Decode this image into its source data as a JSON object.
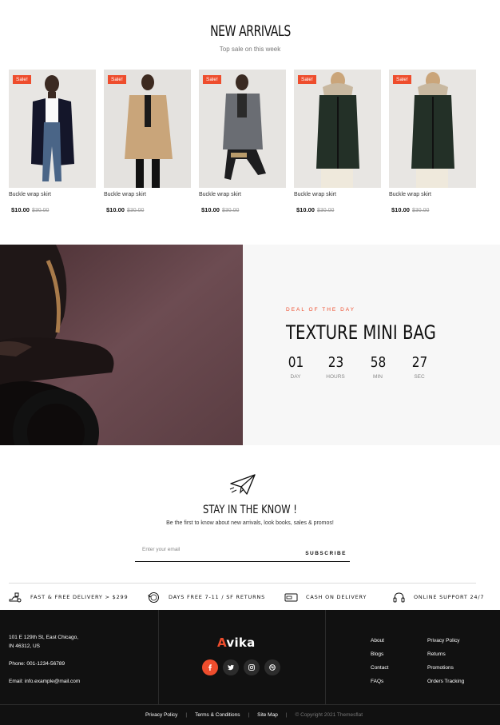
{
  "arrivals": {
    "title": "NEW ARRIVALS",
    "subtitle": "Top sale on this week",
    "products": [
      {
        "badge": "Sale!",
        "name": "Buckle wrap skirt",
        "price": "$10.00",
        "old_price": "$30.00"
      },
      {
        "badge": "Sale!",
        "name": "Buckle wrap skirt",
        "price": "$10.00",
        "old_price": "$30.00"
      },
      {
        "badge": "Sale!",
        "name": "Buckle wrap skirt",
        "price": "$10.00",
        "old_price": "$30.00"
      },
      {
        "badge": "Sale!",
        "name": "Buckle wrap skirt",
        "price": "$10.00",
        "old_price": "$30.00"
      },
      {
        "badge": "Sale!",
        "name": "Buckle wrap skirt",
        "price": "$10.00",
        "old_price": "$30.00"
      }
    ]
  },
  "deal": {
    "kicker": "DEAL OF THE DAY",
    "title": "TEXTURE MINI BAG",
    "countdown": [
      {
        "value": "01",
        "label": "DAY"
      },
      {
        "value": "23",
        "label": "HOURS"
      },
      {
        "value": "58",
        "label": "MIN"
      },
      {
        "value": "27",
        "label": "SEC"
      }
    ]
  },
  "newsletter": {
    "title": "STAY IN THE KNOW !",
    "subtitle": "Be the first to know about new arrivals, look books, sales & promos!",
    "placeholder": "Enter your email",
    "button": "SUBSCRIBE"
  },
  "features": [
    {
      "icon": "delivery-truck-icon",
      "text": "FAST & FREE DELIVERY > $299"
    },
    {
      "icon": "return-icon",
      "text": "DAYS FREE 7-11 / SF RETURNS"
    },
    {
      "icon": "cash-icon",
      "text": "CASH ON DELIVERY"
    },
    {
      "icon": "support-headset-icon",
      "text": "ONLINE SUPPORT 24/7"
    }
  ],
  "footer": {
    "address_line1": "101 E 129th St, East Chicago,",
    "address_line2": "IN 46312, US",
    "phone": "Phone: 001-1234-56789",
    "email": "Email: info.example@mail.com",
    "logo_accent": "A",
    "logo_rest": "vika",
    "socials": [
      "facebook-icon",
      "twitter-icon",
      "instagram-icon",
      "dribbble-icon"
    ],
    "links_col1": [
      "About",
      "Blogs",
      "Contact",
      "FAQs"
    ],
    "links_col2": [
      "Privacy Policy",
      "Returns",
      "Promotions",
      "Orders Tracking"
    ],
    "bottom_links": [
      "Privacy Policy",
      "Terms & Conditions",
      "Site Map"
    ],
    "separator": "|",
    "copyright": "© Copyright 2021 Themesflat"
  },
  "colors": {
    "accent": "#ee4d2d",
    "footer_bg": "#111111",
    "deal_bg": "#f7f7f7"
  }
}
